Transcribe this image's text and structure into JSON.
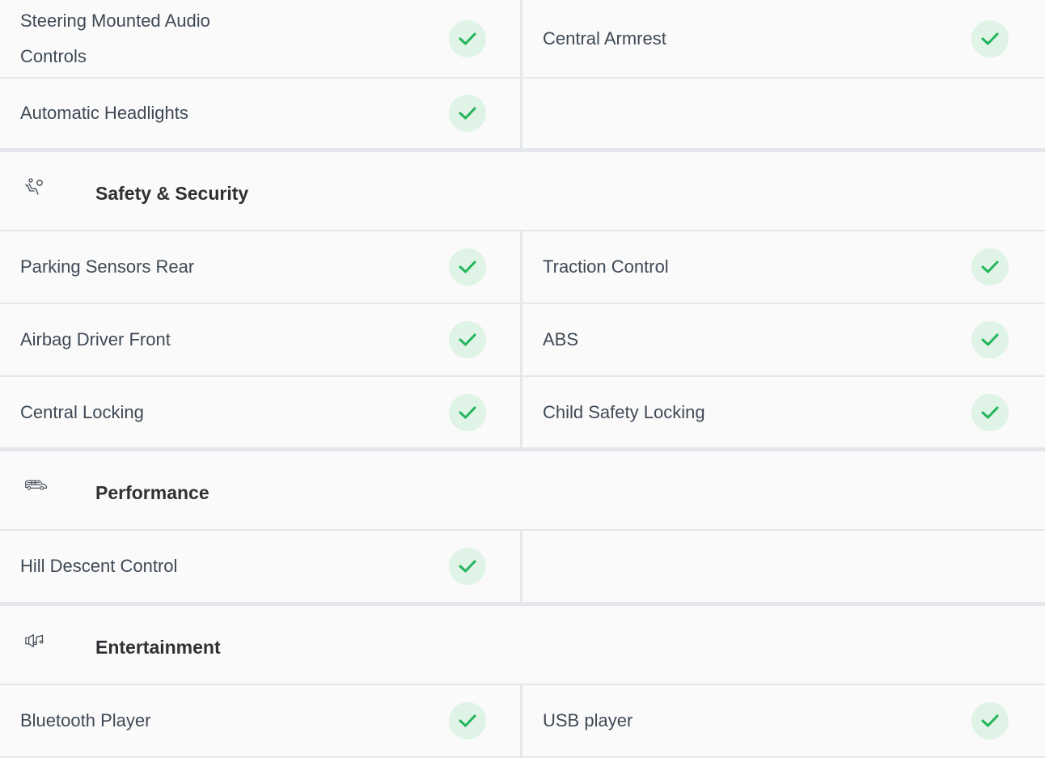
{
  "groups": [
    {
      "rows": [
        {
          "left": {
            "label": "Steering Mounted Audio Controls",
            "available": true
          },
          "right": {
            "label": "Central Armrest",
            "available": true
          }
        },
        {
          "left": {
            "label": "Automatic Headlights",
            "available": true
          },
          "right": null
        }
      ]
    }
  ],
  "sections": [
    {
      "title": "Safety & Security",
      "icon": "airbag-icon",
      "rows": [
        {
          "left": {
            "label": "Parking Sensors Rear",
            "available": true
          },
          "right": {
            "label": "Traction Control",
            "available": true
          }
        },
        {
          "left": {
            "label": "Airbag Driver Front",
            "available": true
          },
          "right": {
            "label": "ABS",
            "available": true
          }
        },
        {
          "left": {
            "label": "Central Locking",
            "available": true
          },
          "right": {
            "label": "Child Safety Locking",
            "available": true
          }
        }
      ]
    },
    {
      "title": "Performance",
      "icon": "car-icon",
      "rows": [
        {
          "left": {
            "label": "Hill Descent Control",
            "available": true
          },
          "right": null
        }
      ]
    },
    {
      "title": "Entertainment",
      "icon": "speaker-music-icon",
      "rows": [
        {
          "left": {
            "label": "Bluetooth Player",
            "available": true
          },
          "right": {
            "label": "USB player",
            "available": true
          }
        }
      ]
    }
  ],
  "colors": {
    "check": "#22b55a",
    "check_bg": "#dff3e6",
    "text": "#3f4955",
    "title": "#2f3033"
  }
}
